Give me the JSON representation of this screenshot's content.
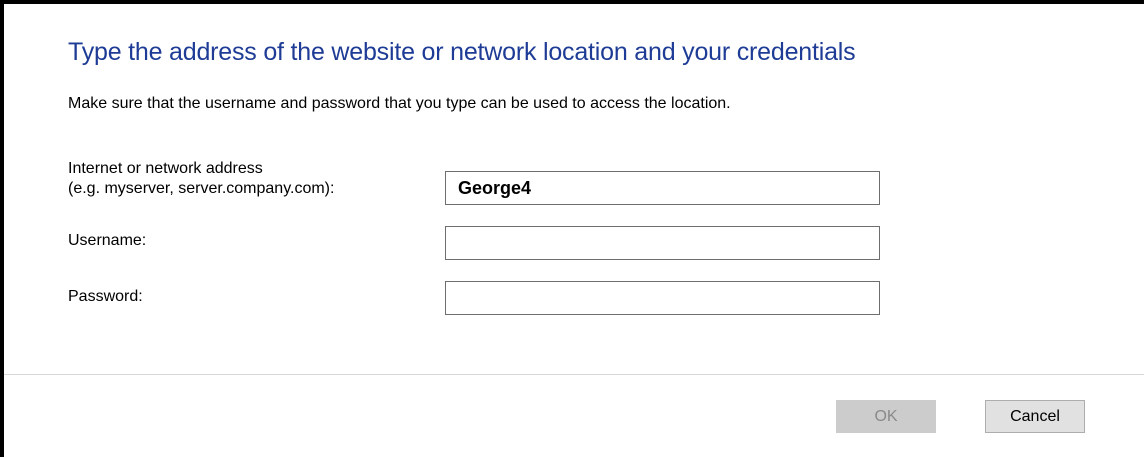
{
  "dialog": {
    "heading": "Type the address of the website or network location and your credentials",
    "description": "Make sure that the username and password that you type can be used to access the location.",
    "address": {
      "label_line1": "Internet or network address",
      "label_line2": "(e.g. myserver, server.company.com):",
      "value": "George4"
    },
    "username": {
      "label": "Username:",
      "value": ""
    },
    "password": {
      "label": "Password:",
      "value": ""
    }
  },
  "buttons": {
    "ok_label": "OK",
    "ok_enabled": false,
    "cancel_label": "Cancel"
  },
  "colors": {
    "heading": "#1e3c96",
    "disabled_button": "#cccccc",
    "button": "#e1e1e1"
  }
}
